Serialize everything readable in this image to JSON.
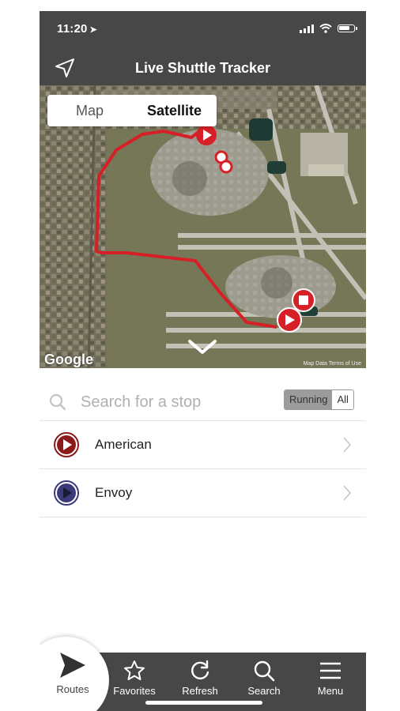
{
  "status": {
    "time": "11:20",
    "location_glyph": "➤"
  },
  "header": {
    "title": "Live Shuttle Tracker",
    "nav_icon": "navigation-arrow-icon"
  },
  "map": {
    "segment": {
      "options": [
        "Map",
        "Satellite"
      ],
      "selected": "Satellite"
    },
    "attribution": "Google",
    "legal": "Map Data   Terms of Use",
    "route_color": "#d61f26"
  },
  "search": {
    "placeholder": "Search for a stop",
    "filter": {
      "options": [
        "Running",
        "All"
      ],
      "selected": "Running"
    }
  },
  "routes": [
    {
      "name": "American",
      "color": "#8b1a1a"
    },
    {
      "name": "Envoy",
      "color": "#3b3a7a"
    }
  ],
  "tabbar": {
    "routes": "Routes",
    "favorites": "Favorites",
    "refresh": "Refresh",
    "search": "Search",
    "menu": "Menu"
  }
}
